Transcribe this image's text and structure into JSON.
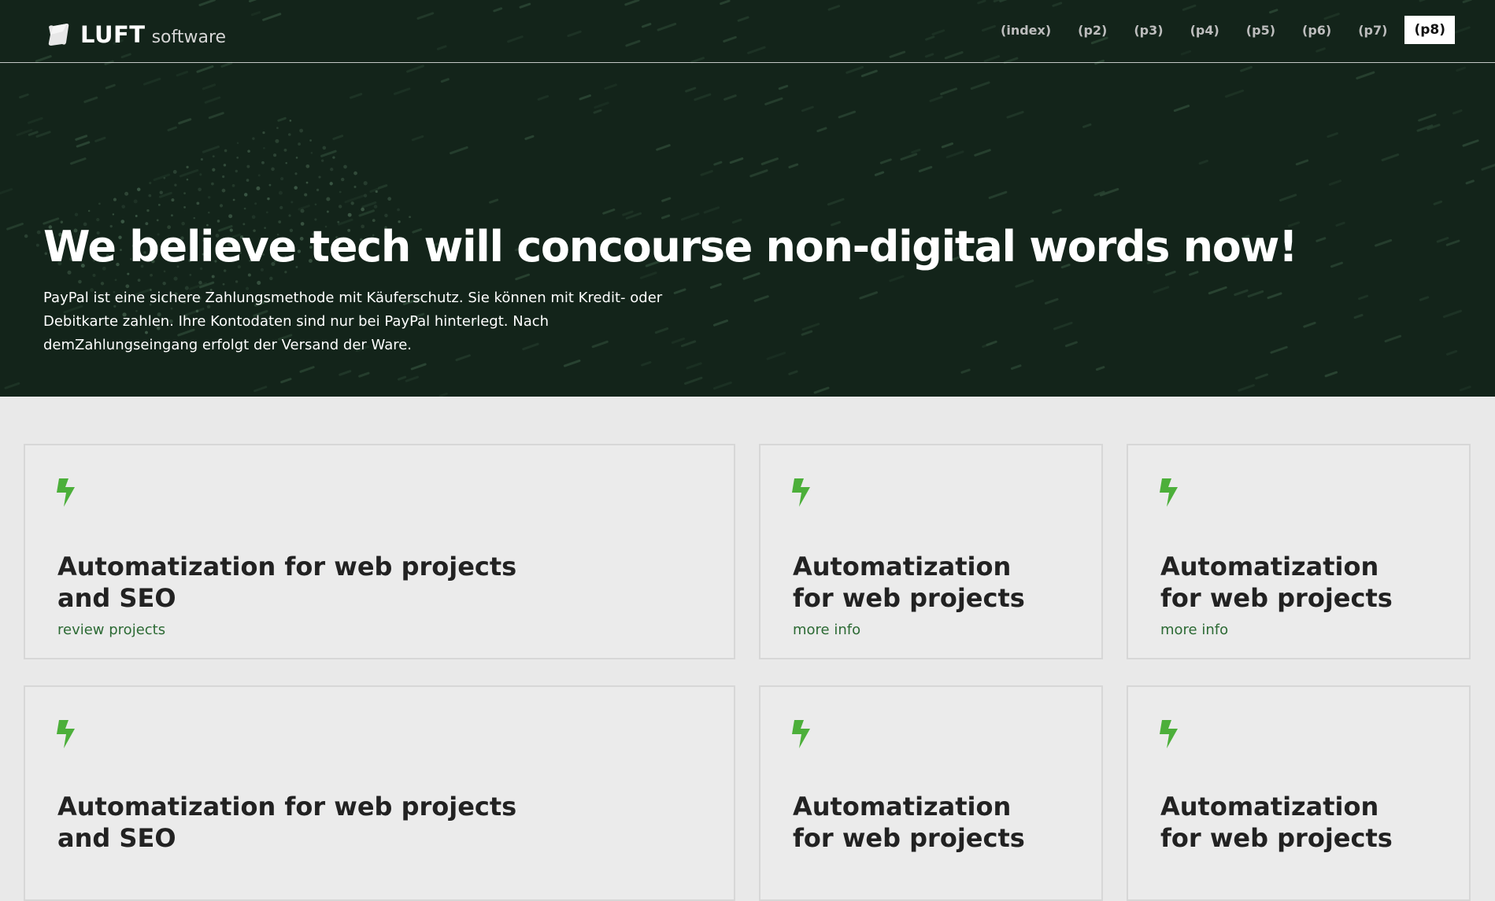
{
  "brand": {
    "name": "LUFT",
    "suffix": "software"
  },
  "nav": {
    "links": [
      "(index)",
      "(p2)",
      "(p3)",
      "(p4)",
      "(p5)",
      "(p6)",
      "(p7)",
      "(p8)"
    ],
    "active_index": 7
  },
  "hero": {
    "title": "We believe tech will concourse non-digital words now!",
    "text": "PayPal ist eine sichere Zahlungsmethode mit Käuferschutz. Sie können mit Kredit- oder Debitkarte zahlen. Ihre Kontodaten sind nur bei PayPal hinterlegt. Nach demZahlungseingang erfolgt der Versand der Ware."
  },
  "cards": [
    {
      "title": "Automatization for web projects and SEO",
      "link": "review projects",
      "icon": "lightning-bolt-icon"
    },
    {
      "title": "Automatization for web projects",
      "link": "more info",
      "icon": "lightning-bolt-icon"
    },
    {
      "title": "Automatization for web projects",
      "link": "more info",
      "icon": "lightning-bolt-icon"
    },
    {
      "title": "Automatization for web projects and SEO",
      "link": "",
      "icon": "lightning-bolt-icon"
    },
    {
      "title": "Automatization for web projects",
      "link": "",
      "icon": "lightning-bolt-icon"
    },
    {
      "title": "Automatization for web projects",
      "link": "",
      "icon": "lightning-bolt-icon"
    }
  ],
  "colors": {
    "hero_bg": "#13241a",
    "accent_green": "#4caf3a",
    "link_green": "#2c6a34",
    "page_bg": "#e9e9e9"
  }
}
